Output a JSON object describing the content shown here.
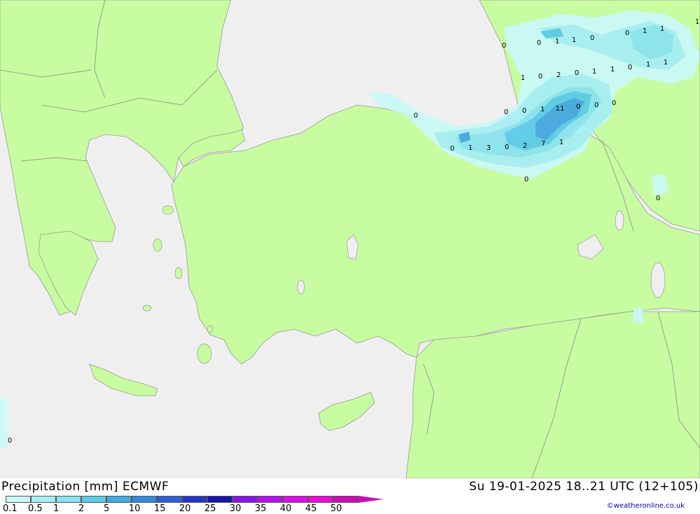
{
  "title": "Precipitation [mm] ECMWF",
  "run_info": "Su 19-01-2025 18..21 UTC (12+105)",
  "copyright": "©weatheronline.co.uk",
  "colors": {
    "sea": "#efefef",
    "land": "#c8fca0",
    "border": "#888888"
  },
  "legend": [
    {
      "label": "0.1",
      "color": "#cbf8f8"
    },
    {
      "label": "0.5",
      "color": "#a8eef4"
    },
    {
      "label": "1",
      "color": "#8ae3ee"
    },
    {
      "label": "2",
      "color": "#5ccbe6"
    },
    {
      "label": "5",
      "color": "#45a8e0"
    },
    {
      "label": "10",
      "color": "#3a86dc"
    },
    {
      "label": "15",
      "color": "#2f5fd5"
    },
    {
      "label": "20",
      "color": "#2538c4"
    },
    {
      "label": "25",
      "color": "#1515a8"
    },
    {
      "label": "30",
      "color": "#8a14e6"
    },
    {
      "label": "35",
      "color": "#b413e8"
    },
    {
      "label": "40",
      "color": "#d711e6"
    },
    {
      "label": "45",
      "color": "#e60fd3"
    },
    {
      "label": "50",
      "color": "#c80fb4"
    }
  ],
  "values": [
    {
      "v": "0"
    },
    {
      "v": "0"
    },
    {
      "v": "1"
    },
    {
      "v": "1"
    },
    {
      "v": "0"
    },
    {
      "v": "0"
    },
    {
      "v": "1"
    },
    {
      "v": "1"
    },
    {
      "v": "1"
    },
    {
      "v": "0"
    },
    {
      "v": "2"
    },
    {
      "v": "0"
    },
    {
      "v": "1"
    },
    {
      "v": "1"
    },
    {
      "v": "0"
    },
    {
      "v": "1"
    },
    {
      "v": "1"
    },
    {
      "v": "0"
    },
    {
      "v": "0"
    },
    {
      "v": "0"
    },
    {
      "v": "1"
    },
    {
      "v": "11"
    },
    {
      "v": "0"
    },
    {
      "v": "0"
    },
    {
      "v": "0"
    },
    {
      "v": "0"
    },
    {
      "v": "1"
    },
    {
      "v": "3"
    },
    {
      "v": "0"
    },
    {
      "v": "2"
    },
    {
      "v": "7"
    },
    {
      "v": "1"
    },
    {
      "v": "0"
    },
    {
      "v": "0"
    },
    {
      "v": "0"
    },
    {
      "v": "1"
    }
  ]
}
